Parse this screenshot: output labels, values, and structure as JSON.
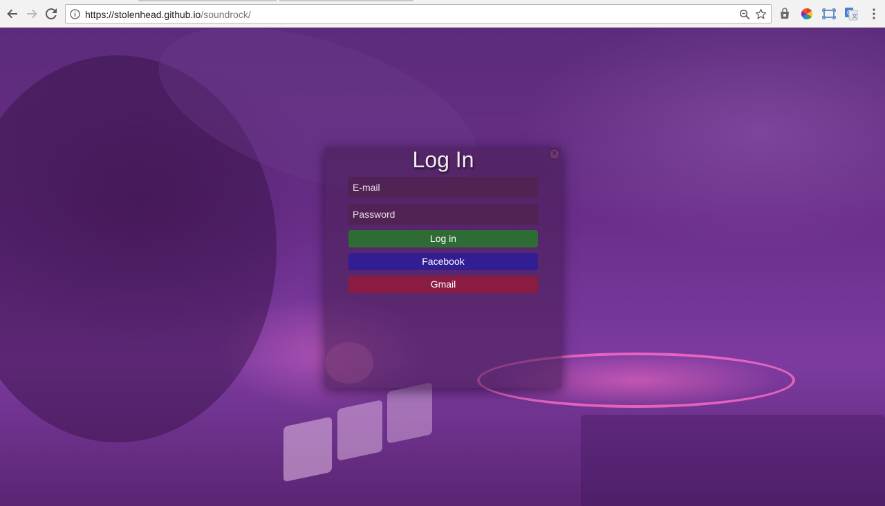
{
  "browser": {
    "url_host": "https://stolenhead.github.io",
    "url_path": "/soundrock/"
  },
  "modal": {
    "title": "Log In",
    "close_label": "×",
    "email_placeholder": "E-mail",
    "password_placeholder": "Password",
    "login_button": "Log in",
    "facebook_button": "Facebook",
    "gmail_button": "Gmail"
  },
  "colors": {
    "login_button": "#2f6b35",
    "facebook_button": "#311e93",
    "gmail_button": "#8a1c42",
    "background_accent": "#6a2e8a"
  },
  "icons": {
    "back": "back-arrow-icon",
    "forward": "forward-arrow-icon",
    "reload": "reload-icon",
    "site_info": "info-icon",
    "zoom": "zoom-icon",
    "bookmark": "star-icon",
    "extensions": [
      "shopping-bag-icon",
      "color-wheel-icon",
      "screenshot-icon",
      "translate-icon"
    ],
    "menu": "kebab-menu-icon"
  }
}
